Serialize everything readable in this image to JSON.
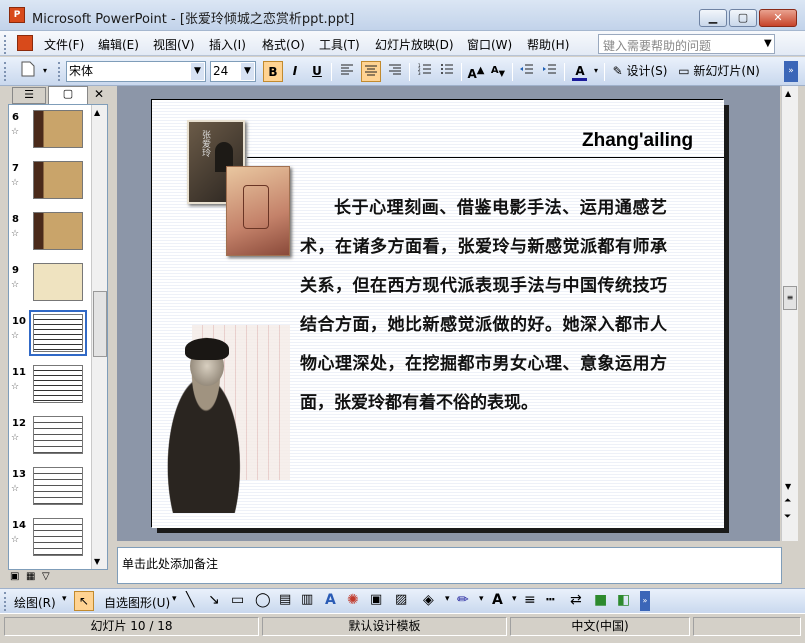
{
  "window": {
    "title": "Microsoft PowerPoint - [张爱玲倾城之恋赏析ppt.ppt]",
    "app_icon_text": "P"
  },
  "menu": {
    "items": [
      "文件(F)",
      "编辑(E)",
      "视图(V)",
      "插入(I)",
      "格式(O)",
      "工具(T)",
      "幻灯片放映(D)",
      "窗口(W)",
      "帮助(H)"
    ],
    "help_placeholder": "键入需要帮助的问题"
  },
  "toolbar": {
    "font": "宋体",
    "size": "24",
    "bold": "B",
    "italic": "I",
    "underline": "U",
    "design_label": "设计(S)",
    "new_slide_label": "新幻灯片(N)"
  },
  "thumbnails": [
    {
      "num": "6",
      "star": "☆"
    },
    {
      "num": "7",
      "star": "☆"
    },
    {
      "num": "8",
      "star": "☆"
    },
    {
      "num": "9",
      "star": "☆"
    },
    {
      "num": "10",
      "star": "☆"
    },
    {
      "num": "11",
      "star": "☆"
    },
    {
      "num": "12",
      "star": "☆"
    },
    {
      "num": "13",
      "star": "☆"
    },
    {
      "num": "14",
      "star": "☆"
    }
  ],
  "slide": {
    "title": "Zhang'ailing",
    "body": "长于心理刻画、借鉴电影手法、运用通感艺术，在诸多方面看，张爱玲与新感觉派都有师承关系，但在西方现代派表现手法与中国传统技巧结合方面，她比新感觉派做的好。她深入都市人物心理深处，在挖掘都市男女心理、意象运用方面，张爱玲都有着不俗的表现。",
    "book_text": "张爱玲"
  },
  "notes": {
    "placeholder": "单击此处添加备注"
  },
  "drawing": {
    "draw_label": "绘图(R)",
    "autoshapes_label": "自选图形(U)"
  },
  "status": {
    "slide": "幻灯片 10 / 18",
    "template": "默认设计模板",
    "language": "中文(中国)"
  }
}
